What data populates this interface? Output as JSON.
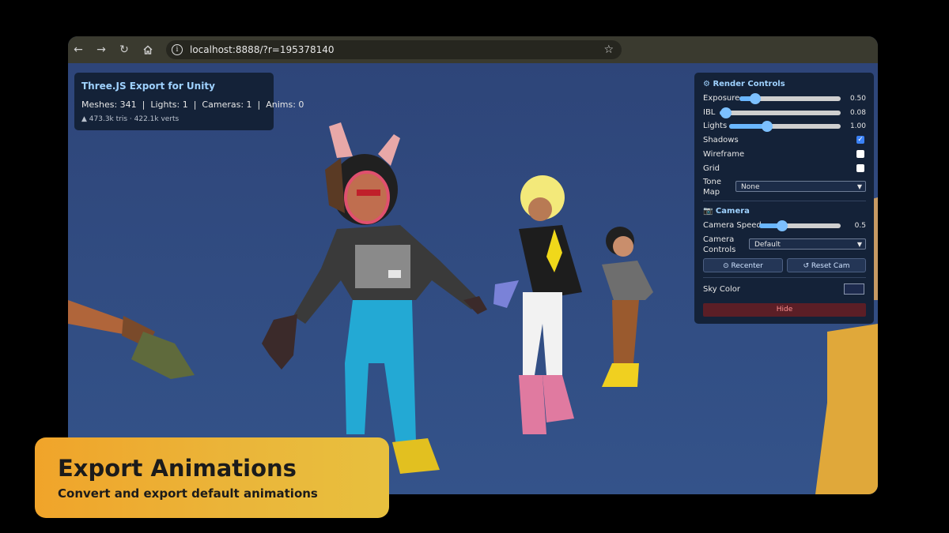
{
  "browser": {
    "url": "localhost:8888/?r=195378140",
    "icons": {
      "back": "arrow-left-icon",
      "forward": "arrow-right-icon",
      "reload": "reload-icon",
      "home": "home-icon",
      "info": "info-icon",
      "bookmark": "star-icon"
    }
  },
  "info_panel": {
    "title": "Three.JS Export for Unity",
    "stats": "Meshes: 341  |  Lights: 1  |  Cameras: 1  |  Anims: 0",
    "geometry": "▲ 473.3k tris  ·  422.1k verts"
  },
  "render_controls": {
    "title": "⚙ Render Controls",
    "exposure": {
      "label": "Exposure",
      "value": "0.50",
      "fraction": 0.16
    },
    "ibl": {
      "label": "IBL",
      "value": "0.08",
      "fraction": 0.05
    },
    "lights": {
      "label": "Lights",
      "value": "1.00",
      "fraction": 0.34
    },
    "shadows": {
      "label": "Shadows",
      "checked": true
    },
    "wireframe": {
      "label": "Wireframe",
      "checked": false
    },
    "grid": {
      "label": "Grid",
      "checked": false
    },
    "tone_map": {
      "label_line1": "Tone",
      "label_line2": "Map",
      "selected": "None"
    }
  },
  "camera": {
    "title": "📷 Camera",
    "speed": {
      "label": "Camera Speed",
      "value": "0.5",
      "fraction": 0.28
    },
    "controls": {
      "label_line1": "Camera",
      "label_line2": "Controls",
      "selected": "Default"
    },
    "recenter_label": "⊙ Recenter",
    "reset_label": "↺ Reset Cam"
  },
  "sky": {
    "label": "Sky Color",
    "color": "#1d2a4d"
  },
  "hide_label": "Hide",
  "caption": {
    "title": "Export Animations",
    "subtitle": "Convert and export default animations"
  }
}
